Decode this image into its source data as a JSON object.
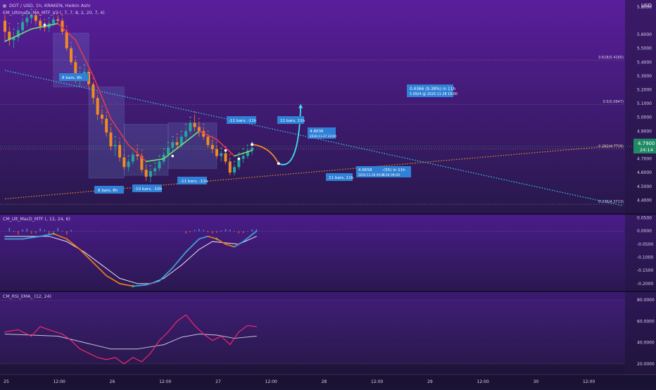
{
  "header": {
    "main": "DOT / USD, 1h, KRAKEN, Heikin Ashi",
    "indicator": "CM_Ultimate_MA_MTF_V2 (, 7, 7, 8, 2, 20, 7, 4)",
    "currency": "USD"
  },
  "macd": {
    "label": "CM_Ult_MacD_MTF (, 12, 24, 6)"
  },
  "rsi": {
    "label": "CM_RSI_EMA_ (12, 24)"
  },
  "last_price": {
    "value": "4.7900",
    "countdown": "24:14"
  },
  "price_axis": {
    "min": 4.3,
    "max": 5.85,
    "ticks": [
      "5.8000",
      "5.6000",
      "5.5000",
      "5.4000",
      "5.3000",
      "5.2000",
      "5.1000",
      "5.0000",
      "4.9000",
      "4.8000",
      "4.7000",
      "4.6000",
      "4.5000",
      "4.4000"
    ],
    "tick_values": [
      5.8,
      5.6,
      5.5,
      5.4,
      5.3,
      5.2,
      5.1,
      5.0,
      4.9,
      4.8,
      4.7,
      4.6,
      4.5,
      4.4
    ]
  },
  "macd_axis": {
    "min": -0.23,
    "max": 0.065,
    "ticks": [
      "0.0500",
      "0.0000",
      "-0.0500",
      "-0.1000",
      "-0.1500",
      "-0.2000"
    ],
    "tick_values": [
      0.05,
      0,
      -0.05,
      -0.1,
      -0.15,
      -0.2
    ]
  },
  "rsi_axis": {
    "min": 10,
    "max": 88,
    "ticks": [
      "80.0000",
      "60.0000",
      "40.0000",
      "20.0000"
    ],
    "tick_values": [
      80,
      60,
      40,
      20
    ]
  },
  "time_axis": {
    "labels": [
      "25",
      "12:00",
      "26",
      "12:00",
      "27",
      "12:00",
      "28",
      "12:00",
      "29",
      "12:00",
      "30",
      "12:00"
    ],
    "hours": [
      0,
      12,
      24,
      36,
      48,
      60,
      72,
      84,
      96,
      108,
      120,
      132
    ]
  },
  "fib_levels": [
    {
      "value": 5.416,
      "label": "0.618(5.4160)"
    },
    {
      "value": 5.0947,
      "label": "0.5(5.0947)"
    },
    {
      "value": 4.7714,
      "label": "0.382(4.7714)"
    },
    {
      "value": 4.3713,
      "label": "0.236(4.3713)"
    }
  ],
  "annotations": {
    "b1": "8 bars, 8h",
    "b2": "8 bars, 8h",
    "b3": "-10 bars, -10h",
    "b4": "-11 bars, -11h",
    "b5": "-11 bars, -11h",
    "b6": "11 bars, 11h",
    "b7": "11 bars, 11h",
    "p1a": "4.8036",
    "p1b": "2020-11-27 23:00",
    "p2a": "4.6658",
    "p2b": "2020-11-28 09:00",
    "p3a": "-(55) in 11h",
    "p3b": "1-28  09:00",
    "t1": "0.4366 (9.38%) in 11h",
    "t2": "5.0924 @ 2020-11-28  19:00"
  },
  "chart_data": [
    {
      "type": "candlestick",
      "title": "DOT / USD, 1h, KRAKEN, Heikin Ashi",
      "ylim": [
        4.3,
        5.85
      ],
      "x_unit": "hours since Nov 25 00:00",
      "candles": [
        [
          0,
          5.7,
          5.74,
          5.55,
          5.62
        ],
        [
          1,
          5.62,
          5.66,
          5.52,
          5.56
        ],
        [
          2,
          5.56,
          5.62,
          5.5,
          5.58
        ],
        [
          3,
          5.58,
          5.66,
          5.55,
          5.63
        ],
        [
          4,
          5.63,
          5.72,
          5.6,
          5.69
        ],
        [
          5,
          5.69,
          5.75,
          5.66,
          5.72
        ],
        [
          6,
          5.72,
          5.76,
          5.68,
          5.74
        ],
        [
          7,
          5.74,
          5.76,
          5.67,
          5.7
        ],
        [
          8,
          5.7,
          5.72,
          5.63,
          5.66
        ],
        [
          9,
          5.66,
          5.69,
          5.62,
          5.65
        ],
        [
          10,
          5.65,
          5.7,
          5.62,
          5.68
        ],
        [
          11,
          5.68,
          5.73,
          5.66,
          5.71
        ],
        [
          12,
          5.71,
          5.74,
          5.67,
          5.7
        ],
        [
          13,
          5.7,
          5.72,
          5.6,
          5.62
        ],
        [
          14,
          5.62,
          5.64,
          5.48,
          5.5
        ],
        [
          15,
          5.5,
          5.52,
          5.38,
          5.4
        ],
        [
          16,
          5.4,
          5.42,
          5.25,
          5.28
        ],
        [
          17,
          5.28,
          5.34,
          5.22,
          5.3
        ],
        [
          18,
          5.3,
          5.36,
          5.26,
          5.33
        ],
        [
          19,
          5.33,
          5.35,
          5.2,
          5.24
        ],
        [
          20,
          5.24,
          5.26,
          5.1,
          5.14
        ],
        [
          21,
          5.14,
          5.16,
          4.98,
          5.02
        ],
        [
          22,
          5.02,
          5.06,
          4.95,
          4.99
        ],
        [
          23,
          4.99,
          5.02,
          4.86,
          4.89
        ],
        [
          24,
          4.89,
          4.93,
          4.76,
          4.79
        ],
        [
          25,
          4.79,
          4.84,
          4.72,
          4.8
        ],
        [
          26,
          4.8,
          4.83,
          4.68,
          4.71
        ],
        [
          27,
          4.71,
          4.74,
          4.62,
          4.64
        ],
        [
          28,
          4.64,
          4.7,
          4.61,
          4.68
        ],
        [
          29,
          4.68,
          4.75,
          4.66,
          4.73
        ],
        [
          30,
          4.73,
          4.78,
          4.69,
          4.72
        ],
        [
          31,
          4.72,
          4.74,
          4.6,
          4.62
        ],
        [
          32,
          4.62,
          4.66,
          4.54,
          4.57
        ],
        [
          33,
          4.57,
          4.63,
          4.53,
          4.61
        ],
        [
          34,
          4.61,
          4.65,
          4.58,
          4.63
        ],
        [
          35,
          4.63,
          4.7,
          4.61,
          4.68
        ],
        [
          36,
          4.68,
          4.75,
          4.66,
          4.73
        ],
        [
          37,
          4.73,
          4.8,
          4.71,
          4.78
        ],
        [
          38,
          4.78,
          4.84,
          4.75,
          4.82
        ],
        [
          39,
          4.82,
          4.86,
          4.77,
          4.8
        ],
        [
          40,
          4.8,
          4.88,
          4.78,
          4.86
        ],
        [
          41,
          4.86,
          4.93,
          4.84,
          4.9
        ],
        [
          42,
          4.9,
          4.98,
          4.88,
          4.96
        ],
        [
          43,
          4.96,
          5.02,
          4.9,
          4.93
        ],
        [
          44,
          4.93,
          4.97,
          4.86,
          4.9
        ],
        [
          45,
          4.9,
          4.93,
          4.84,
          4.86
        ],
        [
          46,
          4.86,
          4.88,
          4.78,
          4.8
        ],
        [
          47,
          4.8,
          4.84,
          4.74,
          4.77
        ],
        [
          48,
          4.77,
          4.8,
          4.7,
          4.72
        ],
        [
          49,
          4.72,
          4.76,
          4.68,
          4.74
        ],
        [
          50,
          4.74,
          4.77,
          4.66,
          4.68
        ],
        [
          51,
          4.68,
          4.71,
          4.58,
          4.6
        ],
        [
          52,
          4.6,
          4.66,
          4.58,
          4.64
        ],
        [
          53,
          4.64,
          4.72,
          4.62,
          4.7
        ],
        [
          54,
          4.7,
          4.75,
          4.67,
          4.72
        ],
        [
          55,
          4.72,
          4.78,
          4.7,
          4.76
        ],
        [
          56,
          4.76,
          4.8,
          4.73,
          4.78
        ]
      ],
      "moving_average": [
        [
          0,
          5.55
        ],
        [
          6,
          5.64
        ],
        [
          12,
          5.68
        ],
        [
          16,
          5.56
        ],
        [
          20,
          5.3
        ],
        [
          24,
          4.99
        ],
        [
          28,
          4.8
        ],
        [
          32,
          4.68
        ],
        [
          36,
          4.7
        ],
        [
          40,
          4.8
        ],
        [
          44,
          4.9
        ],
        [
          48,
          4.84
        ],
        [
          52,
          4.72
        ],
        [
          56,
          4.76
        ]
      ],
      "fib_levels": [
        5.416,
        5.0947,
        4.7714,
        4.3713
      ],
      "trendlines": [
        {
          "name": "descending",
          "points": [
            [
              0,
              5.34
            ],
            [
              140,
              4.36
            ]
          ]
        },
        {
          "name": "ascending",
          "points": [
            [
              0,
              4.41
            ],
            [
              140,
              4.8
            ]
          ]
        }
      ],
      "projection": {
        "from": [
          56,
          4.8036
        ],
        "low": [
          62,
          4.6658
        ],
        "target": [
          67,
          5.0924
        ]
      },
      "last_price": 4.79
    },
    {
      "type": "line",
      "title": "CM_Ult_MacD_MTF (, 12, 24, 6)",
      "ylim": [
        -0.23,
        0.065
      ],
      "series": [
        {
          "values": [
            [
              0,
              -0.03
            ],
            [
              4,
              -0.03
            ],
            [
              8,
              -0.02
            ],
            [
              11,
              -0.01
            ],
            [
              14,
              -0.03
            ],
            [
              17,
              -0.07
            ],
            [
              20,
              -0.12
            ],
            [
              23,
              -0.17
            ],
            [
              26,
              -0.2
            ],
            [
              29,
              -0.21
            ],
            [
              32,
              -0.205
            ],
            [
              35,
              -0.19
            ],
            [
              38,
              -0.14
            ],
            [
              41,
              -0.08
            ],
            [
              44,
              -0.03
            ],
            [
              46,
              -0.02
            ],
            [
              48,
              -0.03
            ],
            [
              50,
              -0.05
            ],
            [
              52,
              -0.06
            ],
            [
              54,
              -0.04
            ],
            [
              57,
              0
            ]
          ]
        },
        {
          "values": [
            [
              0,
              -0.02
            ],
            [
              6,
              -0.02
            ],
            [
              10,
              -0.02
            ],
            [
              14,
              -0.04
            ],
            [
              18,
              -0.08
            ],
            [
              22,
              -0.13
            ],
            [
              26,
              -0.18
            ],
            [
              30,
              -0.2
            ],
            [
              33,
              -0.2
            ],
            [
              36,
              -0.18
            ],
            [
              40,
              -0.13
            ],
            [
              44,
              -0.07
            ],
            [
              47,
              -0.04
            ],
            [
              50,
              -0.045
            ],
            [
              53,
              -0.05
            ],
            [
              57,
              -0.02
            ]
          ]
        }
      ]
    },
    {
      "type": "line",
      "title": "CM_RSI_EMA_ (12, 24)",
      "ylim": [
        10,
        88
      ],
      "series": [
        {
          "values": [
            [
              0,
              50
            ],
            [
              3,
              52
            ],
            [
              6,
              46
            ],
            [
              8,
              55
            ],
            [
              10,
              52
            ],
            [
              13,
              48
            ],
            [
              15,
              42
            ],
            [
              17,
              34
            ],
            [
              19,
              30
            ],
            [
              21,
              26
            ],
            [
              23,
              24
            ],
            [
              25,
              26
            ],
            [
              27,
              20
            ],
            [
              29,
              26
            ],
            [
              31,
              22
            ],
            [
              33,
              30
            ],
            [
              35,
              42
            ],
            [
              37,
              50
            ],
            [
              39,
              60
            ],
            [
              41,
              66
            ],
            [
              43,
              56
            ],
            [
              45,
              48
            ],
            [
              47,
              42
            ],
            [
              49,
              46
            ],
            [
              51,
              38
            ],
            [
              53,
              50
            ],
            [
              55,
              56
            ],
            [
              57,
              55
            ]
          ]
        },
        {
          "values": [
            [
              0,
              48
            ],
            [
              6,
              47
            ],
            [
              12,
              46
            ],
            [
              18,
              40
            ],
            [
              24,
              34
            ],
            [
              30,
              34
            ],
            [
              36,
              38
            ],
            [
              40,
              45
            ],
            [
              44,
              48
            ],
            [
              48,
              47
            ],
            [
              52,
              44
            ],
            [
              57,
              46
            ]
          ]
        }
      ]
    }
  ]
}
